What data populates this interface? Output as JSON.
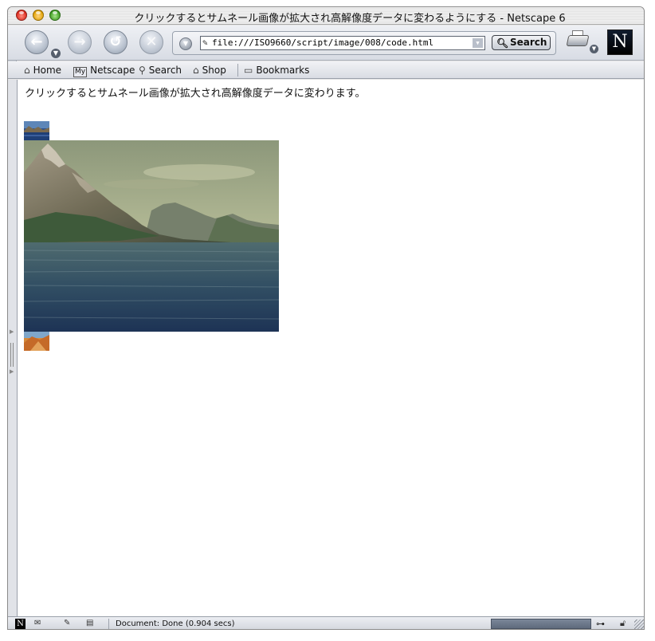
{
  "window": {
    "title": "クリックするとサムネール画像が拡大され高解像度データに変わるようにする - Netscape 6"
  },
  "navbar": {
    "url": "file:///ISO9660/script/image/008/code.html",
    "search_label": "Search"
  },
  "personal_toolbar": {
    "items": [
      {
        "label": "Home",
        "icon": "home-icon"
      },
      {
        "label": "Netscape",
        "icon": "my-netscape-icon"
      },
      {
        "label": "Search",
        "icon": "search-icon"
      },
      {
        "label": "Shop",
        "icon": "shop-icon"
      },
      {
        "label": "Bookmarks",
        "icon": "folder-icon"
      }
    ]
  },
  "page": {
    "description": "クリックするとサムネール画像が拡大され高解像度データに変わります。",
    "images": [
      {
        "name": "thumbnail-mountain-lake"
      },
      {
        "name": "enlarged-mountain-sea"
      },
      {
        "name": "thumbnail-desert"
      }
    ]
  },
  "statusbar": {
    "status_text": "Document: Done (0.904 secs)"
  },
  "colors": {
    "window_chrome": "#e6e6e6",
    "progress": "#6b7689",
    "content_bg": "#ffffff"
  }
}
